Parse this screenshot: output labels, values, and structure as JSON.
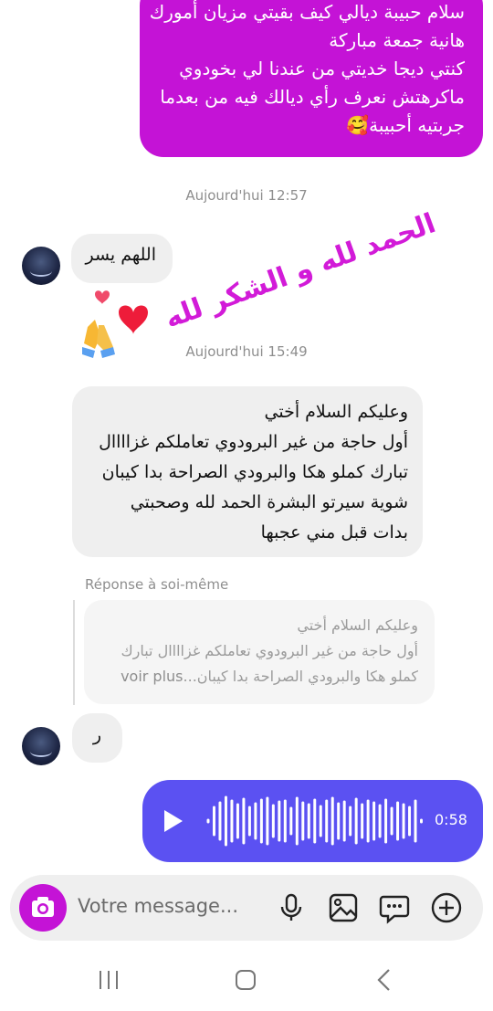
{
  "messages_top": {
    "lines": [
      "سلام حبيبة ديالي كيف بقيتي مزيان أمورك",
      "هانية جمعة مباركة",
      "كنتي ديجا خديتي من عندنا لي بخودوي",
      "ماكرهتش نعرف رأي ديالك فيه من بعدما",
      "جربتيه أحبيبة🥰"
    ]
  },
  "timestamp_1": "Aujourd'hui 12:57",
  "incoming_1": {
    "text": "اللهم يسر"
  },
  "overlay": {
    "line1": "الحمد لله و الشكر لله",
    "emojis": "❤️🙏"
  },
  "timestamp_2": "Aujourd'hui 15:49",
  "incoming_2": {
    "lines": [
      "وعليكم السلام أختي",
      "أول حاجة من غير البرودوي تعاملكم غزاااال",
      "تبارك كملو هكا والبرودي الصراحة بدا كيبان",
      "شوية سيرتو البشرة الحمد لله وصحبتي",
      "بدات قبل مني عجبها"
    ]
  },
  "reply": {
    "label": "Réponse à soi-même",
    "lines": [
      "وعليكم السلام أختي",
      "أول حاجة من غير البرودوي تعاملكم غزاااال تبارك",
      "كملو هكا والبرودي الصراحة بدا كيبان...",
      "voir plus"
    ]
  },
  "incoming_3": {
    "text": "ر"
  },
  "voice_message": {
    "duration": "0:58"
  },
  "composer": {
    "placeholder": "Votre message..."
  },
  "colors": {
    "accent_purple": "#c413d6",
    "voice_blue": "#5b51f2",
    "bubble_gray": "#efefef"
  },
  "icons": [
    "camera-icon",
    "microphone-icon",
    "gallery-icon",
    "sticker-icon",
    "add-icon",
    "play-icon",
    "recents-icon",
    "home-icon",
    "back-icon"
  ]
}
